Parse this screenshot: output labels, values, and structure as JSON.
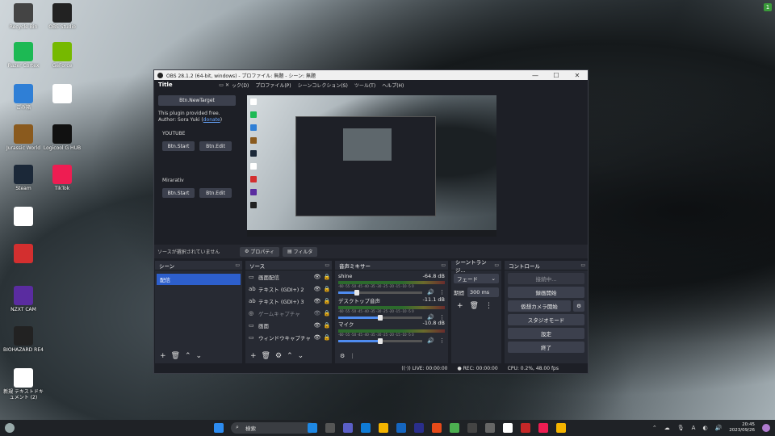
{
  "desktop_icons": [
    {
      "label": "Recycle Bin",
      "color": "#444"
    },
    {
      "label": "OBS Studio",
      "color": "#222"
    },
    {
      "label": "Razer Cortex",
      "color": "#1db954"
    },
    {
      "label": "GeForce",
      "color": "#76b900"
    },
    {
      "label": "ごみ箱",
      "color": "#2f7fd6"
    },
    {
      "label": "",
      "color": "#ffffff"
    },
    {
      "label": "Jurassic World",
      "color": "#8a5a1e"
    },
    {
      "label": "Logicool G HUB",
      "color": "#111"
    },
    {
      "label": "Steam",
      "color": "#1b2838"
    },
    {
      "label": "TikTok",
      "color": "#ee1d52"
    },
    {
      "label": "",
      "color": "#ffffff"
    },
    {
      "label": "",
      "color": "#d32f2f"
    },
    {
      "label": "NZXT CAM",
      "color": "#5a2ca0"
    },
    {
      "label": "BIOHAZARD RE4",
      "color": "#222"
    },
    {
      "label": "新規 テキストドキュメント (2)",
      "color": "#ffffff"
    }
  ],
  "corner_badge": "1",
  "obs": {
    "window_title": "OBS 28.1.2 (64-bit, windows) - プロファイル: 無題 - シーン: 無題",
    "menu": [
      "ック(D)",
      "プロファイル(P)",
      "シーンコレクション(S)",
      "ツール(T)",
      "ヘルプ(H)"
    ],
    "dock": {
      "title": "Title",
      "new_target": "Btn.NewTarget",
      "text1": "This plugin provided free.",
      "author": "Author: Sora Yuki (",
      "author_link": "donate",
      "author_tail": ")",
      "sections": [
        {
          "name": "YOUTUBE",
          "start": "Btn.Start",
          "edit": "Btn.Edit"
        },
        {
          "name": "Mirarativ",
          "start": "Btn.Start",
          "edit": "Btn.Edit"
        }
      ]
    },
    "status_source": "ソースが選択されていません",
    "properties_btn": "プロパティ",
    "filters_btn": "フィルタ",
    "scenes": {
      "title": "シーン",
      "items": [
        "配信"
      ]
    },
    "sources": {
      "title": "ソース",
      "items": [
        {
          "name": "画面配信",
          "icon": "▭",
          "dim": false
        },
        {
          "name": "テキスト (GDI+) 2",
          "icon": "ab",
          "dim": false
        },
        {
          "name": "テキスト (GDI+) 3",
          "icon": "ab",
          "dim": false
        },
        {
          "name": "ゲームキャプチャ",
          "icon": "◎",
          "dim": true
        },
        {
          "name": "画面",
          "icon": "▭",
          "dim": false
        },
        {
          "name": "ウィンドウキャプチャ 2",
          "icon": "▭",
          "dim": false
        }
      ]
    },
    "mixer": {
      "title": "音声ミキサー",
      "ticks": "-60 -55 -50 -45 -40 -35 -30 -25 -20 -15 -10 -5 0",
      "channels": [
        {
          "name": "shine",
          "db": "-64.8 dB",
          "level": 0.22
        },
        {
          "name": "デスクトップ音声",
          "db": "-11.1 dB",
          "level": 0.5
        },
        {
          "name": "マイク",
          "db": "-10.8 dB",
          "level": 0.5
        }
      ]
    },
    "transitions": {
      "title": "シーントランジ...",
      "type": "フェード",
      "duration_label": "期間",
      "duration": "300 ms"
    },
    "controls": {
      "title": "コントロール",
      "connecting": "接続中...",
      "record": "録画開始",
      "virtual_cam": "仮想カメラ開始",
      "studio": "スタジオモード",
      "settings": "設定",
      "exit": "終了"
    },
    "status": {
      "live": "LIVE: 00:00:00",
      "rec": "REC: 00:00:00",
      "cpu": "CPU: 0.2%, 48.00 fps"
    }
  },
  "taskbar": {
    "search": "検索",
    "time": "20:45",
    "date": "2023/09/26",
    "lang": "A"
  }
}
